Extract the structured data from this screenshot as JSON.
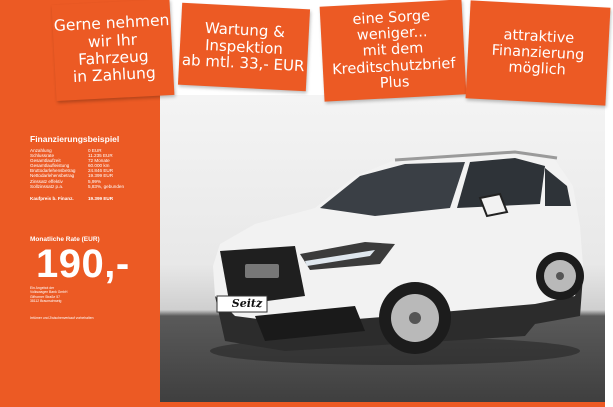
{
  "banners": [
    {
      "lines": [
        "Gerne nehmen",
        "wir Ihr",
        "Fahrzeug",
        "in Zahlung"
      ]
    },
    {
      "lines": [
        "Wartung &",
        "Inspektion",
        "ab mtl. 33,- EUR"
      ]
    },
    {
      "lines": [
        "eine Sorge weniger...",
        "mit dem",
        "Kreditschutzbrief",
        "Plus"
      ]
    },
    {
      "lines": [
        "attraktive",
        "Finanzierung",
        "möglich"
      ]
    }
  ],
  "financing": {
    "title": "Finanzierungsbeispiel",
    "rows": [
      {
        "label": "Anzahlung",
        "value": "0 EUR"
      },
      {
        "label": "Schlussrate",
        "value": "11.235 EUR"
      },
      {
        "label": "Gesamtlaufzeit",
        "value": "72 Monate"
      },
      {
        "label": "Gesamtlaufleistung",
        "value": "60.000 km"
      },
      {
        "label": "Bruttodarlehensbetrag",
        "value": "24.846 EUR"
      },
      {
        "label": "Nettodarlehensbetrag",
        "value": "19.399 EUR"
      },
      {
        "label": "Zinssatz effektiv",
        "value": "5,99%"
      },
      {
        "label": "Sollzinssatz p.a.",
        "value": "5,83%, gebunden"
      }
    ],
    "kaufpreis": {
      "label": "Kaufpreis b. Finanz.",
      "value": "19.399 EUR"
    },
    "rate_label": "Monatliche Rate (EUR)",
    "rate_value": "190,-",
    "bank_lines": [
      "Ein Angebot der",
      "Volkswagen Bank GmbH",
      "Gifhorner Straße 57",
      "38112 Braunschweig"
    ],
    "note": "Irrtümer und Zwischenverkauf vorbehalten"
  },
  "plate_text": "Seitz",
  "colors": {
    "accent": "#ec5a24",
    "car_body": "#f2f2f2",
    "showroom_floor": "#3f3f3f"
  }
}
